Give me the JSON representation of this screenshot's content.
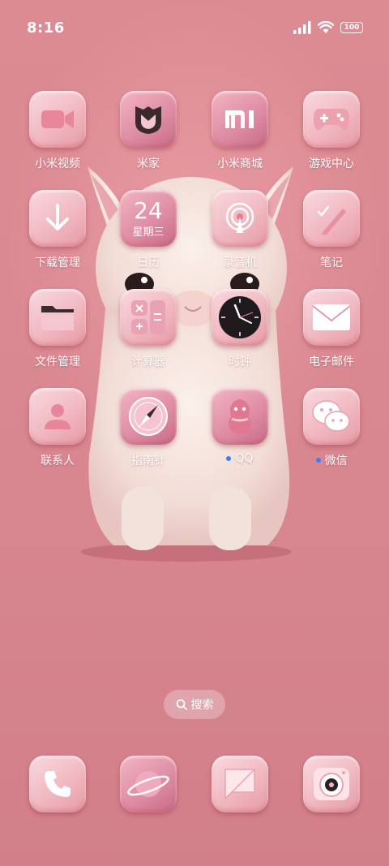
{
  "status_bar": {
    "time": "8:16",
    "battery": "100"
  },
  "apps": [
    {
      "label": "小米视频",
      "icon": "video-camera-icon"
    },
    {
      "label": "米家",
      "icon": "mijia-icon"
    },
    {
      "label": "小米商城",
      "icon": "mi-logo-icon"
    },
    {
      "label": "游戏中心",
      "icon": "gamepad-icon"
    },
    {
      "label": "下载管理",
      "icon": "download-arrow-icon"
    },
    {
      "label": "日历",
      "icon": "calendar-icon",
      "date": "24",
      "weekday": "星期三"
    },
    {
      "label": "录音机",
      "icon": "recorder-icon"
    },
    {
      "label": "笔记",
      "icon": "pen-notes-icon"
    },
    {
      "label": "文件管理",
      "icon": "folder-icon"
    },
    {
      "label": "计算器",
      "icon": "calculator-icon"
    },
    {
      "label": "时钟",
      "icon": "clock-icon"
    },
    {
      "label": "电子邮件",
      "icon": "envelope-icon"
    },
    {
      "label": "联系人",
      "icon": "person-icon"
    },
    {
      "label": "指南针",
      "icon": "compass-icon"
    },
    {
      "label": "QQ",
      "icon": "penguin-icon",
      "new_dot": true
    },
    {
      "label": "微信",
      "icon": "wechat-bubbles-icon",
      "new_dot": true
    }
  ],
  "search": {
    "label": "搜索"
  },
  "dock": [
    {
      "icon": "phone-icon"
    },
    {
      "icon": "planet-browser-icon"
    },
    {
      "icon": "message-icon"
    },
    {
      "icon": "camera-icon"
    }
  ],
  "colors": {
    "background": "#d9838c",
    "tile_light": "#f9d9de",
    "tile_mid": "#f1b8c1",
    "new_dot": "#3d7bff"
  }
}
